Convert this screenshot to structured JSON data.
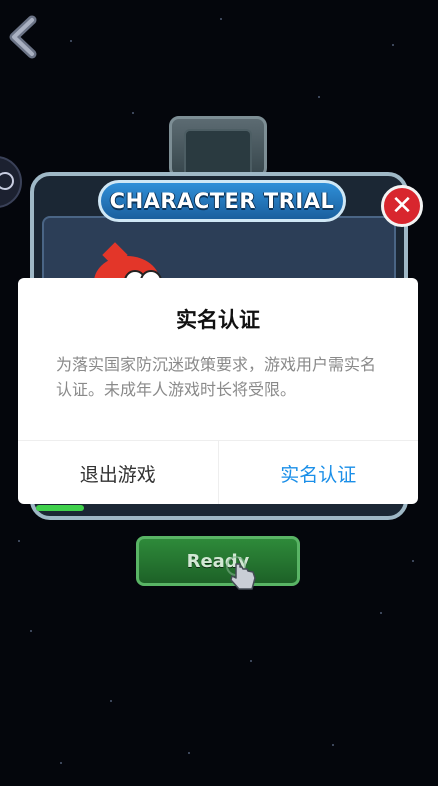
{
  "game": {
    "banner_title": "CHARACTER TRIAL",
    "ready_label": "Ready",
    "close_glyph": "✕",
    "progress": 0.13
  },
  "dialog": {
    "title": "实名认证",
    "body": "为落实国家防沉迷政策要求，游戏用户需实名认证。未成年人游戏时长将受限。",
    "exit_label": "退出游戏",
    "verify_label": "实名认证"
  },
  "colors": {
    "accent": "#1b8fe8",
    "close_red": "#d8262e",
    "ready_green": "#2e8a3a",
    "banner_blue": "#2f8fd8"
  },
  "icons": [
    "back-arrow-icon",
    "side-menu-icon",
    "close-icon",
    "hand-pointer-icon"
  ]
}
